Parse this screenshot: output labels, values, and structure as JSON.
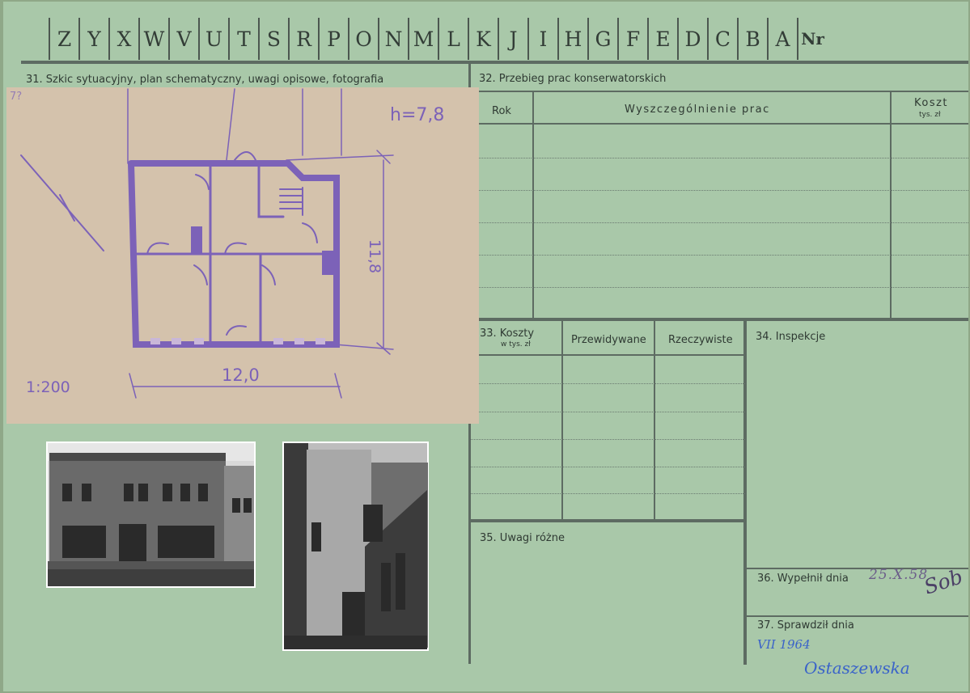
{
  "index_letters": [
    "Z",
    "Y",
    "X",
    "W",
    "V",
    "U",
    "T",
    "S",
    "R",
    "P",
    "O",
    "N",
    "M",
    "L",
    "K",
    "J",
    "I",
    "H",
    "G",
    "F",
    "E",
    "D",
    "C",
    "B",
    "A"
  ],
  "index_nr": "Nr",
  "section31": {
    "label": "31. Szkic sytuacyjny, plan schematyczny, uwagi opisowe, fotografia"
  },
  "sketch": {
    "corner_note": "7?",
    "height_note": "h=7,8",
    "width_dim": "12,0",
    "depth_dim": "11,8",
    "scale": "1:200"
  },
  "section32": {
    "label": "32. Przebieg prac konserwatorskich",
    "col_year": "Rok",
    "col_works": "Wyszczególnienie prac",
    "col_cost": "Koszt",
    "col_cost_unit": "tys. zł"
  },
  "section33": {
    "label": "33. Koszty",
    "unit": "w tys. zł",
    "col_planned": "Przewidywane",
    "col_actual": "Rzeczywiste"
  },
  "section34": {
    "label": "34. Inspekcje"
  },
  "section35": {
    "label": "35. Uwagi różne"
  },
  "section36": {
    "label": "36. Wypełnił dnia",
    "date": "25.X.58",
    "signature": "Sob"
  },
  "section37": {
    "label": "37. Sprawdził dnia",
    "date": "VII 1964",
    "signature": "Ostaszewska"
  },
  "colors": {
    "card": "#a9c8a9",
    "paper_insert": "#d4c2ac",
    "pencil": "#7c62b8",
    "ink_blue": "#3a63c9",
    "rule": "#5d6b62"
  }
}
